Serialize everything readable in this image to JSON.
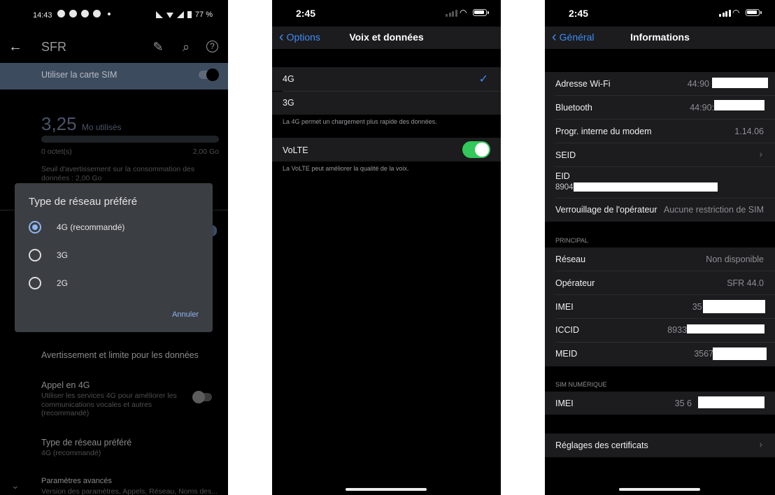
{
  "android": {
    "status": {
      "time": "14:43",
      "battery": "77 %"
    },
    "appbar": {
      "title": "SFR"
    },
    "sim": {
      "label": "Utiliser la carte SIM"
    },
    "usage": {
      "value": "3,25",
      "unit": "Mo utilisés",
      "min": "0 octet(s)",
      "max": "2,00 Go",
      "warning": "Seuil d'avertissement sur la consommation des données : 2,00 Go"
    },
    "dialog": {
      "title": "Type de réseau préféré",
      "options": [
        "4G (recommandé)",
        "3G",
        "2G"
      ],
      "selected": 0,
      "cancel": "Annuler"
    },
    "items": [
      {
        "title": "Avertissement et limite pour les données"
      },
      {
        "title": "Appel en 4G",
        "subtitle": "Utiliser les services 4G pour améliorer les communications vocales et autres (recommandé)"
      },
      {
        "title": "Type de réseau préféré",
        "subtitle": "4G (recommandé)"
      },
      {
        "title": "Paramètres avancés",
        "subtitle": "Version des paramètres, Appels, Réseau, Noms des..."
      }
    ]
  },
  "voice": {
    "status": {
      "time": "2:45"
    },
    "nav": {
      "back": "Options",
      "title": "Voix et données"
    },
    "options": [
      "4G",
      "3G"
    ],
    "selected": "4G",
    "footer_4g": "La 4G permet un chargement plus rapide des données.",
    "volte": {
      "label": "VoLTE",
      "on": true
    },
    "footer_volte": "La VoLTE peut améliorer la qualité de la voix."
  },
  "info": {
    "status": {
      "time": "2:45"
    },
    "nav": {
      "back": "Général",
      "title": "Informations"
    },
    "rows": [
      {
        "label": "Adresse Wi-Fi",
        "value": "44:90"
      },
      {
        "label": "Bluetooth",
        "value": "44:90:"
      },
      {
        "label": "Progr. interne du modem",
        "value": "1.14.06"
      },
      {
        "label": "SEID",
        "value": ""
      },
      {
        "label": "EID",
        "value": "8904"
      },
      {
        "label": "Verrouillage de l'opérateur",
        "value": "Aucune restriction de SIM"
      }
    ],
    "principal_header": "PRINCIPAL",
    "principal": [
      {
        "label": "Réseau",
        "value": "Non disponible"
      },
      {
        "label": "Opérateur",
        "value": "SFR 44.0"
      },
      {
        "label": "IMEI",
        "value": "35 67"
      },
      {
        "label": "ICCID",
        "value": "8933"
      },
      {
        "label": "MEID",
        "value": "3567"
      }
    ],
    "esim_header": "SIM NUMÉRIQUE",
    "esim": [
      {
        "label": "IMEI",
        "value": "35 6"
      }
    ],
    "certs": "Réglages des certificats"
  }
}
